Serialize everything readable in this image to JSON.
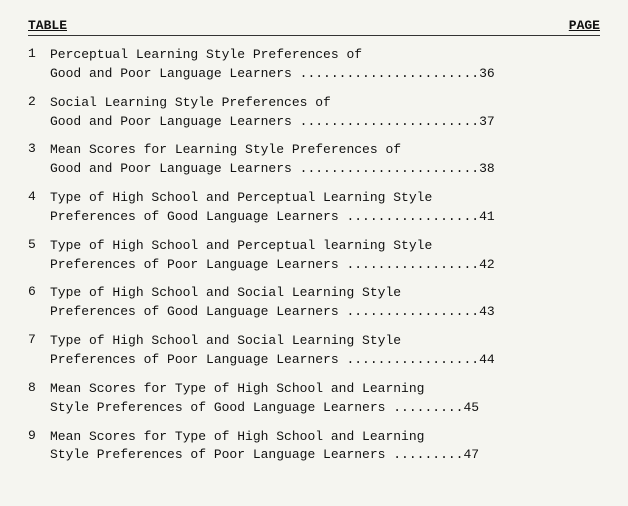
{
  "header": {
    "left_label": "TABLE",
    "right_label": "PAGE"
  },
  "entries": [
    {
      "number": "1",
      "lines": [
        "Perceptual Learning Style Preferences of",
        "Good and Poor Language Learners .......................36"
      ]
    },
    {
      "number": "2",
      "lines": [
        "Social Learning Style Preferences of",
        "Good and Poor Language Learners .......................37"
      ]
    },
    {
      "number": "3",
      "lines": [
        "Mean Scores for Learning Style Preferences of",
        "Good and Poor Language Learners .......................38"
      ]
    },
    {
      "number": "4",
      "lines": [
        "Type of High School and Perceptual Learning Style",
        "Preferences of Good Language Learners .................41"
      ]
    },
    {
      "number": "5",
      "lines": [
        "Type of High School and Perceptual learning Style",
        "Preferences of Poor Language Learners .................42"
      ]
    },
    {
      "number": "6",
      "lines": [
        "Type of High School and Social Learning Style",
        "Preferences of Good Language Learners .................43"
      ]
    },
    {
      "number": "7",
      "lines": [
        "Type of High School and Social Learning Style",
        "Preferences of Poor Language Learners .................44"
      ]
    },
    {
      "number": "8",
      "lines": [
        "Mean Scores for Type of High School and Learning",
        "Style Preferences of Good Language Learners .........45"
      ]
    },
    {
      "number": "9",
      "lines": [
        "Mean Scores for Type of High School and Learning",
        "Style Preferences of Poor Language Learners .........47"
      ]
    }
  ]
}
